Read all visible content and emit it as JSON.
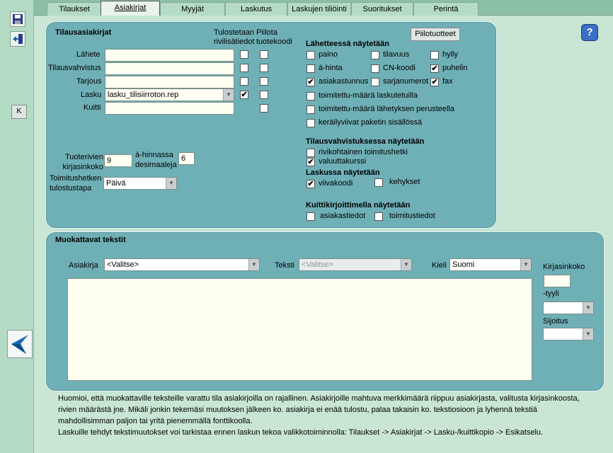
{
  "tabs": [
    {
      "label": "Tilaukset",
      "active": false
    },
    {
      "label": "Asiakirjat",
      "active": true
    },
    {
      "label": "Myyjät",
      "active": false
    },
    {
      "label": "Laskutus",
      "active": false
    },
    {
      "label": "Laskujen tiliöinti",
      "active": false
    },
    {
      "label": "Suoritukset",
      "active": false
    },
    {
      "label": "Perintä",
      "active": false
    }
  ],
  "left": {
    "k_label": "K"
  },
  "help": {
    "label": "?"
  },
  "tilausasiakirjat": {
    "title": "Tilausasiakirjat",
    "col_print_line": "Tulostetaan rivilisätiedot",
    "col_hide_code": "Piilota tuotekoodi",
    "hidden_products_button": "Piilotuotteet",
    "rows": [
      {
        "label": "Lähete",
        "value": "",
        "print": false,
        "hide": false
      },
      {
        "label": "Tilausvahvistus",
        "value": "",
        "print": false,
        "hide": false
      },
      {
        "label": "Tarjous",
        "value": "",
        "print": false,
        "hide": false
      },
      {
        "label": "Lasku",
        "value": "lasku_tilisiirroton.rep",
        "print": true,
        "hide": false
      },
      {
        "label": "Kuitti",
        "value": "",
        "hide": false
      }
    ],
    "font_size_label": "Tuoterivien kirjasinkoko",
    "font_size_value": "9",
    "decimals_label": "á-hinnassa desimaaleja",
    "decimals_value": "6",
    "delivery_print_label": "Toimitushetken tulostustapa",
    "delivery_print_value": "Päivä"
  },
  "lahete": {
    "title": "Lähetteessä näytetään",
    "items": [
      {
        "label": "paino",
        "checked": false
      },
      {
        "label": "tilavuus",
        "checked": false
      },
      {
        "label": "hylly",
        "checked": false
      },
      {
        "label": "á-hinta",
        "checked": false
      },
      {
        "label": "CN-koodi",
        "checked": false
      },
      {
        "label": "puhelin",
        "checked": true
      },
      {
        "label": "asiakastunnus",
        "checked": true
      },
      {
        "label": "sarjanumerot",
        "checked": false
      },
      {
        "label": "fax",
        "checked": true
      },
      {
        "label": "toimitettu-määrä laskutetuilla",
        "checked": false
      },
      {
        "label": "toimitettu-määrä lähetyksen perusteella",
        "checked": false
      },
      {
        "label": "keräilyviivat paketin sisällössä",
        "checked": false
      }
    ]
  },
  "vahvistus": {
    "title": "Tilausvahvistuksessa näytetään",
    "items": [
      {
        "label": "rivikohtainen toimitushetki",
        "checked": false
      },
      {
        "label": "valuuttakurssi",
        "checked": true
      }
    ]
  },
  "laskussa": {
    "title": "Laskussa näytetään",
    "items": [
      {
        "label": "viivakoodi",
        "checked": true
      },
      {
        "label": "kehykset",
        "checked": false
      }
    ]
  },
  "kuitti": {
    "title": "Kuittikirjoittimella näytetään",
    "items": [
      {
        "label": "asiakastiedot",
        "checked": false
      },
      {
        "label": "toimitustiedot",
        "checked": false
      }
    ]
  },
  "muokattavat": {
    "title": "Muokattavat tekstit",
    "doc_label": "Asiakirja",
    "doc_value": "<Valitse>",
    "text_label": "Teksti",
    "text_value": "<Valitse>",
    "lang_label": "Kieli",
    "lang_value": "Suomi",
    "fontsize_label": "Kirjasinkoko",
    "style_label": "-tyyli",
    "placement_label": "Sijoitus",
    "text_area": ""
  },
  "note": {
    "line1": "Huomioi, että muokattaville teksteille varattu tila asiakirjoilla on rajallinen. Asiakirjoille mahtuva merkkimäärä riippuu asiakirjasta, valitusta kirjasinkoosta,",
    "line2": "rivien määrästä jne. Mikäli jonkin tekemäsi muutoksen jälkeen ko. asiakirja ei enää tulostu, palaa takaisin ko. tekstiosioon ja lyhennä tekstiä",
    "line3": "mahdollisimman paljon tai yritä pienemmällä fonttikoolla.",
    "line4": "Laskuille tehdyt tekstimuutokset voi tarkistaa ennen laskun tekoa valikkotoiminnolla: Tilaukset -> Asiakirjat -> Lasku-/kuittikopio -> Esikatselu."
  },
  "colors": {
    "panel": "#6fb0b7",
    "background": "#c8e6d3",
    "tabbar": "#8cc0a5"
  }
}
